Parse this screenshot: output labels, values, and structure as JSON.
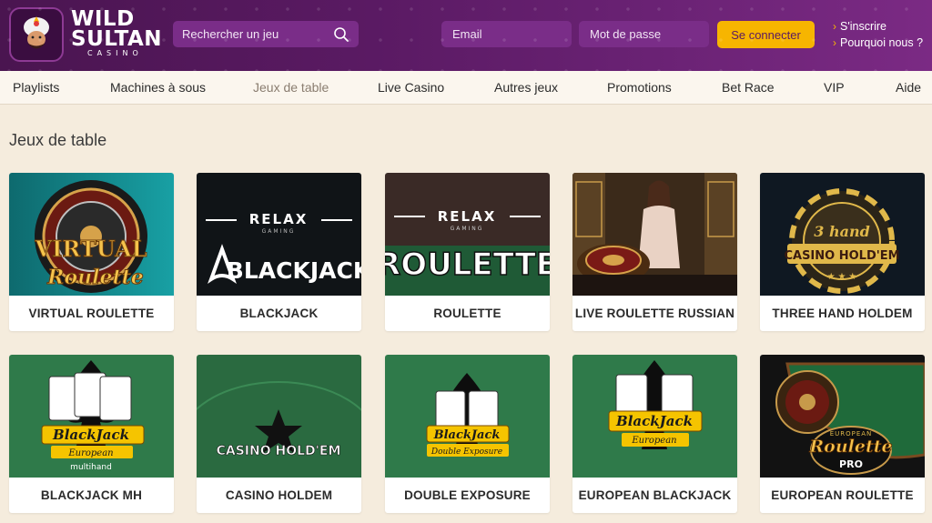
{
  "header": {
    "logo": {
      "line1": "WILD",
      "line2": "SULTAN",
      "line3": "CASINO"
    },
    "search_placeholder": "Rechercher un jeu",
    "email_placeholder": "Email",
    "password_placeholder": "Mot de passe",
    "login_label": "Se connecter",
    "links": [
      "S'inscrire",
      "Pourquoi nous ?"
    ]
  },
  "nav": {
    "items": [
      "Playlists",
      "Machines à sous",
      "Jeux de table",
      "Live Casino",
      "Autres jeux",
      "Promotions",
      "Bet Race",
      "VIP",
      "Aide"
    ],
    "active_index": 2
  },
  "section": {
    "title": "Jeux de table"
  },
  "games": [
    {
      "label": "VIRTUAL ROULETTE",
      "art": [
        "VIRTUAL",
        "Roulette"
      ]
    },
    {
      "label": "BLACKJACK",
      "art": [
        "RELAX",
        "GAMING",
        "BLACKJACK"
      ]
    },
    {
      "label": "ROULETTE",
      "art": [
        "RELAX",
        "GAMING",
        "ROULETTE"
      ]
    },
    {
      "label": "LIVE ROULETTE RUSSIAN",
      "art": []
    },
    {
      "label": "THREE HAND HOLDEM",
      "art": [
        "3 hand",
        "CASINO HOLD'EM"
      ]
    },
    {
      "label": "BLACKJACK MH",
      "art": [
        "BlackJack",
        "European",
        "multihand"
      ]
    },
    {
      "label": "CASINO HOLDEM",
      "art": [
        "CASINO HOLD'EM"
      ]
    },
    {
      "label": "DOUBLE EXPOSURE",
      "art": [
        "BlackJack",
        "Double Exposure"
      ]
    },
    {
      "label": "EUROPEAN BLACKJACK",
      "art": [
        "BlackJack",
        "European"
      ]
    },
    {
      "label": "EUROPEAN ROULETTE",
      "art": [
        "EUROPEAN",
        "Roulette",
        "PRO"
      ]
    }
  ],
  "colors": {
    "header": "#5a1a63",
    "accent": "#f7b500",
    "background": "#f5ecdd"
  }
}
